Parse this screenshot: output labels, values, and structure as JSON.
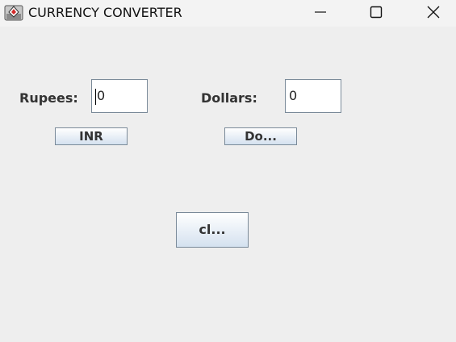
{
  "window": {
    "title": "CURRENCY CONVERTER",
    "controls": {
      "minimize": "minimize-icon",
      "maximize": "maximize-icon",
      "close": "close-icon"
    }
  },
  "form": {
    "rupees_label": "Rupees:",
    "rupees_value": "0",
    "dollars_label": "Dollars:",
    "dollars_value": "0",
    "inr_button": "INR",
    "dollar_button": "Do...",
    "clear_button": "cl..."
  },
  "colors": {
    "background": "#eeeeee",
    "titlebar": "#f3f3f3",
    "label_text": "#333333",
    "button_gradient_top": "#ffffff",
    "button_gradient_bottom": "#d4e1ef",
    "border": "#7a8a99"
  }
}
